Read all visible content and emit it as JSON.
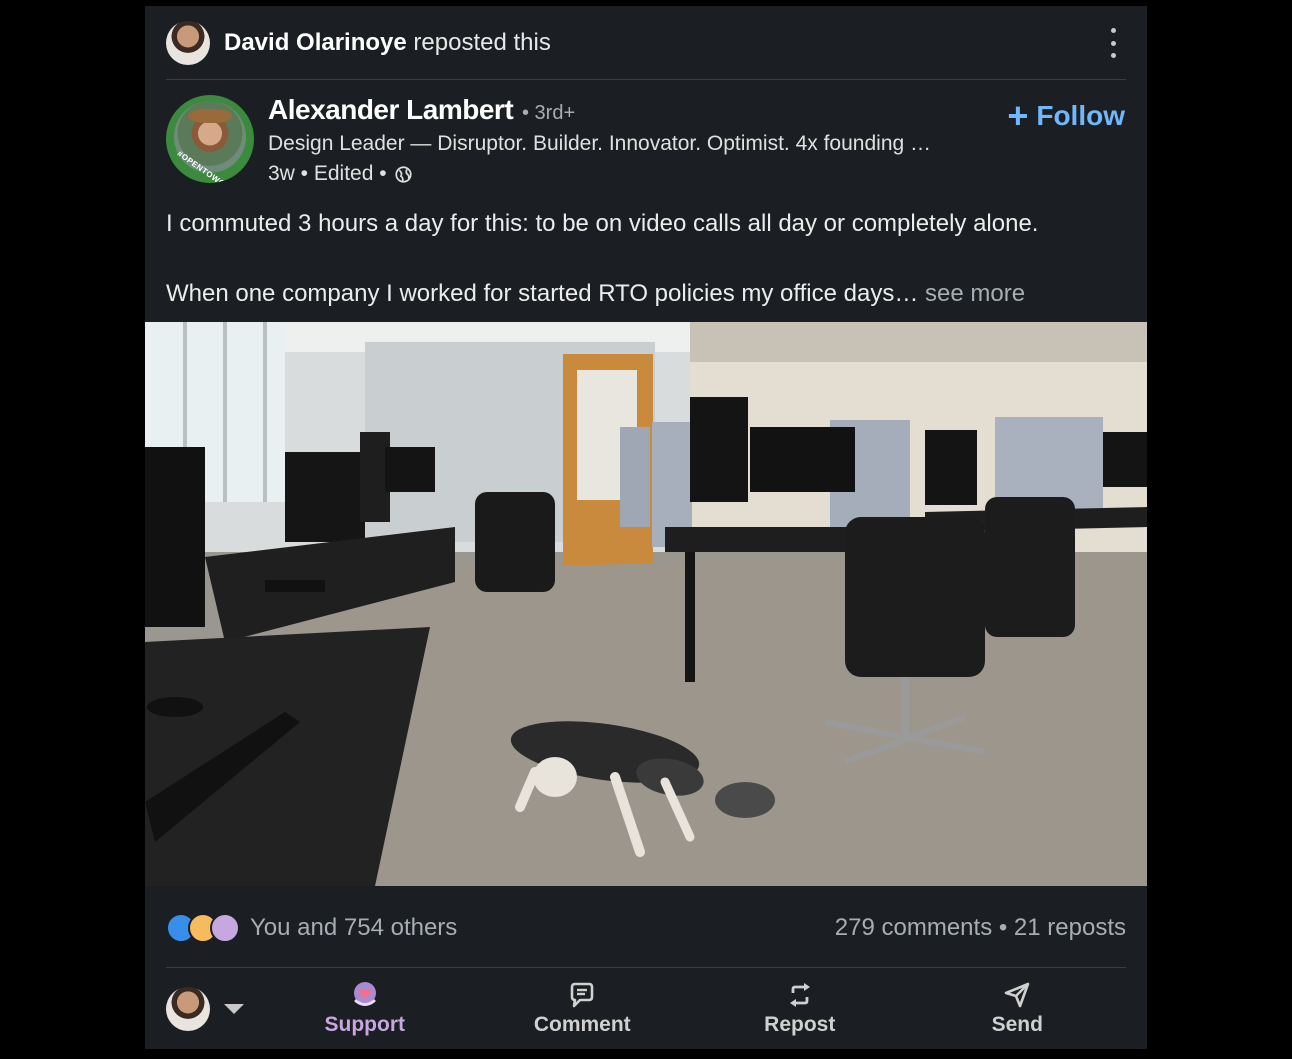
{
  "repost": {
    "reposter_name": "David Olarinoye",
    "reposter_suffix": " reposted this"
  },
  "author": {
    "name": "Alexander Lambert",
    "degree": "• 3rd+",
    "headline": "Design Leader — Disruptor. Builder. Innovator. Optimist. 4x founding …",
    "meta": "3w • Edited •",
    "badge": "#OPENTOWORK"
  },
  "follow": {
    "plus": "+",
    "label": "Follow"
  },
  "post": {
    "line1": "I commuted 3 hours a day for this: to be on video calls all day or completely alone.",
    "line2": "When one company I worked for started RTO policies my office days…",
    "see_more": " see more"
  },
  "social": {
    "reactions_text": "You and 754 others",
    "stats_text": "279 comments • 21 reposts",
    "reaction_icons": [
      "like-icon",
      "insightful-icon",
      "support-icon"
    ]
  },
  "actions": {
    "support": "Support",
    "comment": "Comment",
    "repost": "Repost",
    "send": "Send"
  },
  "colors": {
    "background": "#000000",
    "card": "#1b1f23",
    "accent": "#71b7fb",
    "support": "#c6a7df"
  }
}
